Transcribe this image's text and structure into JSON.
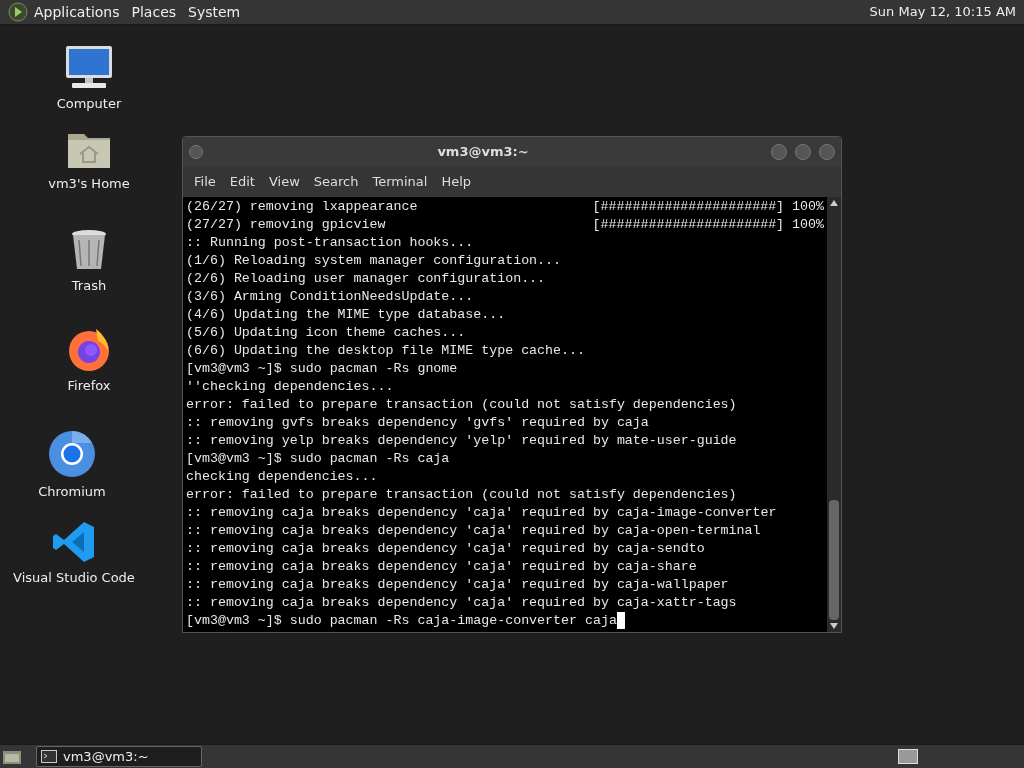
{
  "top_panel": {
    "menus": [
      "Applications",
      "Places",
      "System"
    ],
    "clock": "Sun May 12, 10:15 AM"
  },
  "desktop_icons": [
    {
      "kind": "computer",
      "label": "Computer"
    },
    {
      "kind": "home",
      "label": "vm3's Home"
    },
    {
      "kind": "trash",
      "label": "Trash"
    },
    {
      "kind": "firefox",
      "label": "Firefox"
    },
    {
      "kind": "chromium",
      "label": "Chromium"
    },
    {
      "kind": "vscode",
      "label": "Visual Studio Code"
    }
  ],
  "terminal_window": {
    "title": "vm3@vm3:~",
    "menu": [
      "File",
      "Edit",
      "View",
      "Search",
      "Terminal",
      "Help"
    ],
    "lines": [
      {
        "text": "(26/27) removing lxappearance",
        "progress": "[######################] 100%"
      },
      {
        "text": "(27/27) removing gpicview",
        "progress": "[######################] 100%"
      },
      {
        "text": ":: Running post-transaction hooks..."
      },
      {
        "text": "(1/6) Reloading system manager configuration..."
      },
      {
        "text": "(2/6) Reloading user manager configuration..."
      },
      {
        "text": "(3/6) Arming ConditionNeedsUpdate..."
      },
      {
        "text": "(4/6) Updating the MIME type database..."
      },
      {
        "text": "(5/6) Updating icon theme caches..."
      },
      {
        "text": "(6/6) Updating the desktop file MIME type cache..."
      },
      {
        "text": "[vm3@vm3 ~]$ sudo pacman -Rs gnome"
      },
      {
        "text": "''checking dependencies..."
      },
      {
        "text": "error: failed to prepare transaction (could not satisfy dependencies)"
      },
      {
        "text": ":: removing gvfs breaks dependency 'gvfs' required by caja"
      },
      {
        "text": ":: removing yelp breaks dependency 'yelp' required by mate-user-guide"
      },
      {
        "text": "[vm3@vm3 ~]$ sudo pacman -Rs caja"
      },
      {
        "text": "checking dependencies..."
      },
      {
        "text": "error: failed to prepare transaction (could not satisfy dependencies)"
      },
      {
        "text": ":: removing caja breaks dependency 'caja' required by caja-image-converter"
      },
      {
        "text": ":: removing caja breaks dependency 'caja' required by caja-open-terminal"
      },
      {
        "text": ":: removing caja breaks dependency 'caja' required by caja-sendto"
      },
      {
        "text": ":: removing caja breaks dependency 'caja' required by caja-share"
      },
      {
        "text": ":: removing caja breaks dependency 'caja' required by caja-wallpaper"
      },
      {
        "text": ":: removing caja breaks dependency 'caja' required by caja-xattr-tags"
      },
      {
        "text": "[vm3@vm3 ~]$ sudo pacman -Rs caja-image-converter caja",
        "cursor": true
      }
    ]
  },
  "taskbar": {
    "tasks": [
      {
        "label": "vm3@vm3:~",
        "selected": true
      }
    ]
  }
}
